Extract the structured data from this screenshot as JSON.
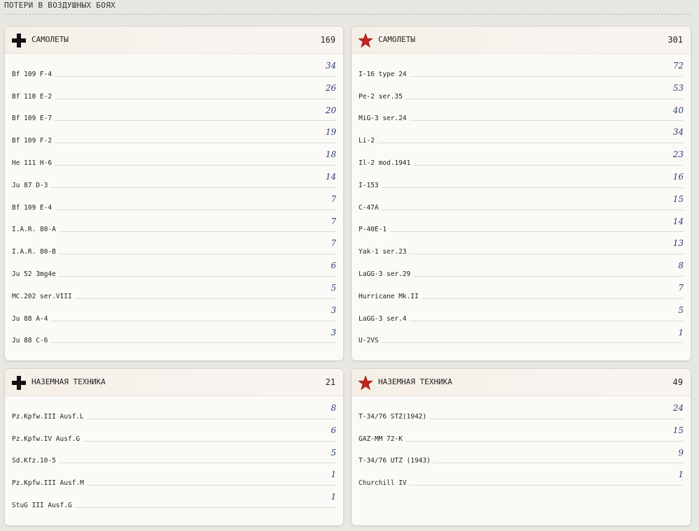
{
  "section_title": "ПОТЕРИ В ВОЗДУШНЫХ БОЯХ",
  "colors": {
    "background": "#e9e7e2",
    "card": "#fbfaf6",
    "value_ink": "#2f3f7a",
    "soviet_star": "#c0251f",
    "german_cross": "#111111"
  },
  "cards": {
    "german_aircraft": {
      "icon": "balkenkreuz-icon",
      "title": "САМОЛЕТЫ",
      "total": "169",
      "rows": [
        {
          "name": "Bf 109 F-4",
          "value": "34"
        },
        {
          "name": "Bf 110 E-2",
          "value": "26"
        },
        {
          "name": "Bf 109 E-7",
          "value": "20"
        },
        {
          "name": "Bf 109 F-2",
          "value": "19"
        },
        {
          "name": "He 111 H-6",
          "value": "18"
        },
        {
          "name": "Ju 87 D-3",
          "value": "14"
        },
        {
          "name": "Bf 109 E-4",
          "value": "7"
        },
        {
          "name": "I.A.R. 80-A",
          "value": "7"
        },
        {
          "name": "I.A.R. 80-B",
          "value": "7"
        },
        {
          "name": "Ju 52 3mg4e",
          "value": "6"
        },
        {
          "name": "MC.202 ser.VIII",
          "value": "5"
        },
        {
          "name": "Ju 88 A-4",
          "value": "3"
        },
        {
          "name": "Ju 88 C-6",
          "value": "3"
        }
      ]
    },
    "soviet_aircraft": {
      "icon": "red-star-icon",
      "title": "САМОЛЕТЫ",
      "total": "301",
      "rows": [
        {
          "name": "I-16 type 24",
          "value": "72"
        },
        {
          "name": "Pe-2 ser.35",
          "value": "53"
        },
        {
          "name": "MiG-3 ser.24",
          "value": "40"
        },
        {
          "name": "Li-2",
          "value": "34"
        },
        {
          "name": "Il-2 mod.1941",
          "value": "23"
        },
        {
          "name": "I-153",
          "value": "16"
        },
        {
          "name": "C-47A",
          "value": "15"
        },
        {
          "name": "P-40E-1",
          "value": "14"
        },
        {
          "name": "Yak-1 ser.23",
          "value": "13"
        },
        {
          "name": "LaGG-3 ser.29",
          "value": "8"
        },
        {
          "name": "Hurricane Mk.II",
          "value": "7"
        },
        {
          "name": "LaGG-3 ser.4",
          "value": "5"
        },
        {
          "name": "U-2VS",
          "value": "1"
        }
      ]
    },
    "german_ground": {
      "icon": "balkenkreuz-icon",
      "title": "НАЗЕМНАЯ ТЕХНИКА",
      "total": "21",
      "rows": [
        {
          "name": "Pz.Kpfw.III Ausf.L",
          "value": "8"
        },
        {
          "name": "Pz.Kpfw.IV Ausf.G",
          "value": "6"
        },
        {
          "name": "Sd.Kfz.10-5",
          "value": "5"
        },
        {
          "name": "Pz.Kpfw.III Ausf.M",
          "value": "1"
        },
        {
          "name": "StuG III Ausf.G",
          "value": "1"
        }
      ]
    },
    "soviet_ground": {
      "icon": "red-star-icon",
      "title": "НАЗЕМНАЯ ТЕХНИКА",
      "total": "49",
      "rows": [
        {
          "name": "T-34/76 STZ(1942)",
          "value": "24"
        },
        {
          "name": "GAZ-MM 72-K",
          "value": "15"
        },
        {
          "name": "T-34/76 UTZ (1943)",
          "value": "9"
        },
        {
          "name": "Churchill IV",
          "value": "1"
        }
      ]
    }
  }
}
